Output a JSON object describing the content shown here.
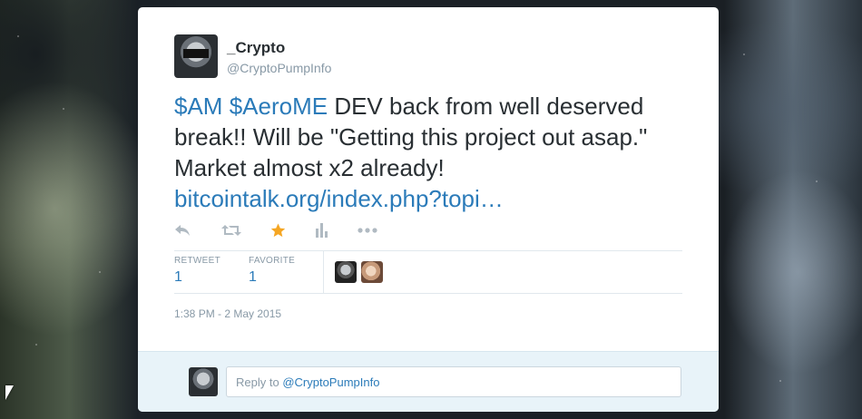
{
  "tweet": {
    "author": {
      "name": "_Crypto",
      "handle": "@CryptoPumpInfo"
    },
    "text": {
      "cashtag1": "$AM",
      "cashtag2": "$AeroME",
      "body": " DEV back from well deserved break!! Will be \"Getting this project out asap.\" Market almost x2 already! ",
      "link": "bitcointalk.org/index.php?topi…"
    },
    "actions": {
      "reply_icon": "reply-icon",
      "retweet_icon": "retweet-icon",
      "favorite_icon": "star-icon",
      "analytics_icon": "bar-chart-icon",
      "more_icon": "more-dots-icon",
      "favorite_color": "#f5a623"
    },
    "stats": {
      "retweet_label": "RETWEET",
      "retweet_count": "1",
      "favorite_label": "FAVORITE",
      "favorite_count": "1"
    },
    "timestamp": "1:38 PM - 2 May 2015"
  },
  "reply": {
    "prefix": "Reply to ",
    "handle": "@CryptoPumpInfo"
  },
  "colors": {
    "link": "#2b7bb9",
    "text": "#292f33",
    "muted": "#8899a6",
    "reply_bar": "#e8f3f9"
  }
}
